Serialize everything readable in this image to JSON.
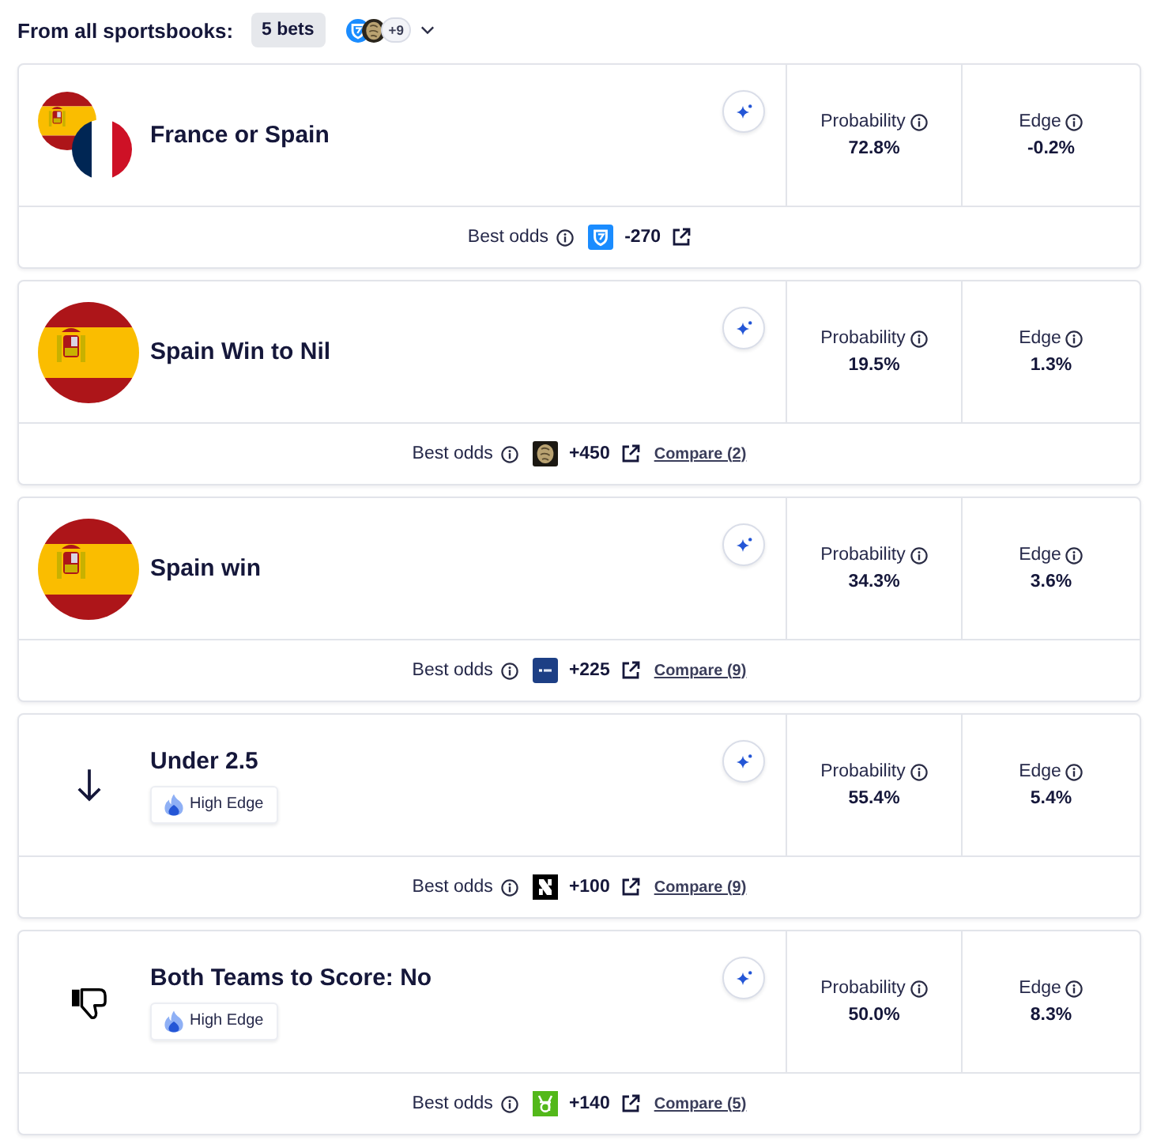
{
  "header": {
    "label": "From all sportsbooks:",
    "bet_count": "5 bets",
    "books": [
      {
        "kind": "shield"
      },
      {
        "kind": "emblem"
      }
    ],
    "more_books": "+9"
  },
  "bets": [
    {
      "title": "France or Spain",
      "icon": {
        "kind": "flag-pair"
      },
      "probability_label": "Probability",
      "probability": "72.8%",
      "edge_label": "Edge",
      "edge": "-0.2%",
      "best_odds_label": "Best odds",
      "book": {
        "kind": "shield"
      },
      "odds": "-270"
    },
    {
      "title": "Spain Win to Nil",
      "icon": {
        "kind": "flag-es"
      },
      "probability_label": "Probability",
      "probability": "19.5%",
      "edge_label": "Edge",
      "edge": "1.3%",
      "best_odds_label": "Best odds",
      "book": {
        "kind": "emblem"
      },
      "odds": "+450",
      "compare": "Compare (2)"
    },
    {
      "title": "Spain win",
      "icon": {
        "kind": "flag-es"
      },
      "probability_label": "Probability",
      "probability": "34.3%",
      "edge_label": "Edge",
      "edge": "3.6%",
      "best_odds_label": "Best odds",
      "book": {
        "kind": "bet-tile"
      },
      "odds": "+225",
      "compare": "Compare (9)"
    },
    {
      "title": "Under 2.5",
      "icon": {
        "kind": "arrow-down"
      },
      "tag": "High Edge",
      "probability_label": "Probability",
      "probability": "55.4%",
      "edge_label": "Edge",
      "edge": "5.4%",
      "best_odds_label": "Best odds",
      "book": {
        "kind": "n-tile"
      },
      "odds": "+100",
      "compare": "Compare (9)"
    },
    {
      "title": "Both Teams to Score: No",
      "icon": {
        "kind": "thumbs-down"
      },
      "tag": "High Edge",
      "probability_label": "Probability",
      "probability": "50.0%",
      "edge_label": "Edge",
      "edge": "8.3%",
      "best_odds_label": "Best odds",
      "book": {
        "kind": "green-tile"
      },
      "odds": "+140",
      "compare": "Compare (5)"
    }
  ]
}
